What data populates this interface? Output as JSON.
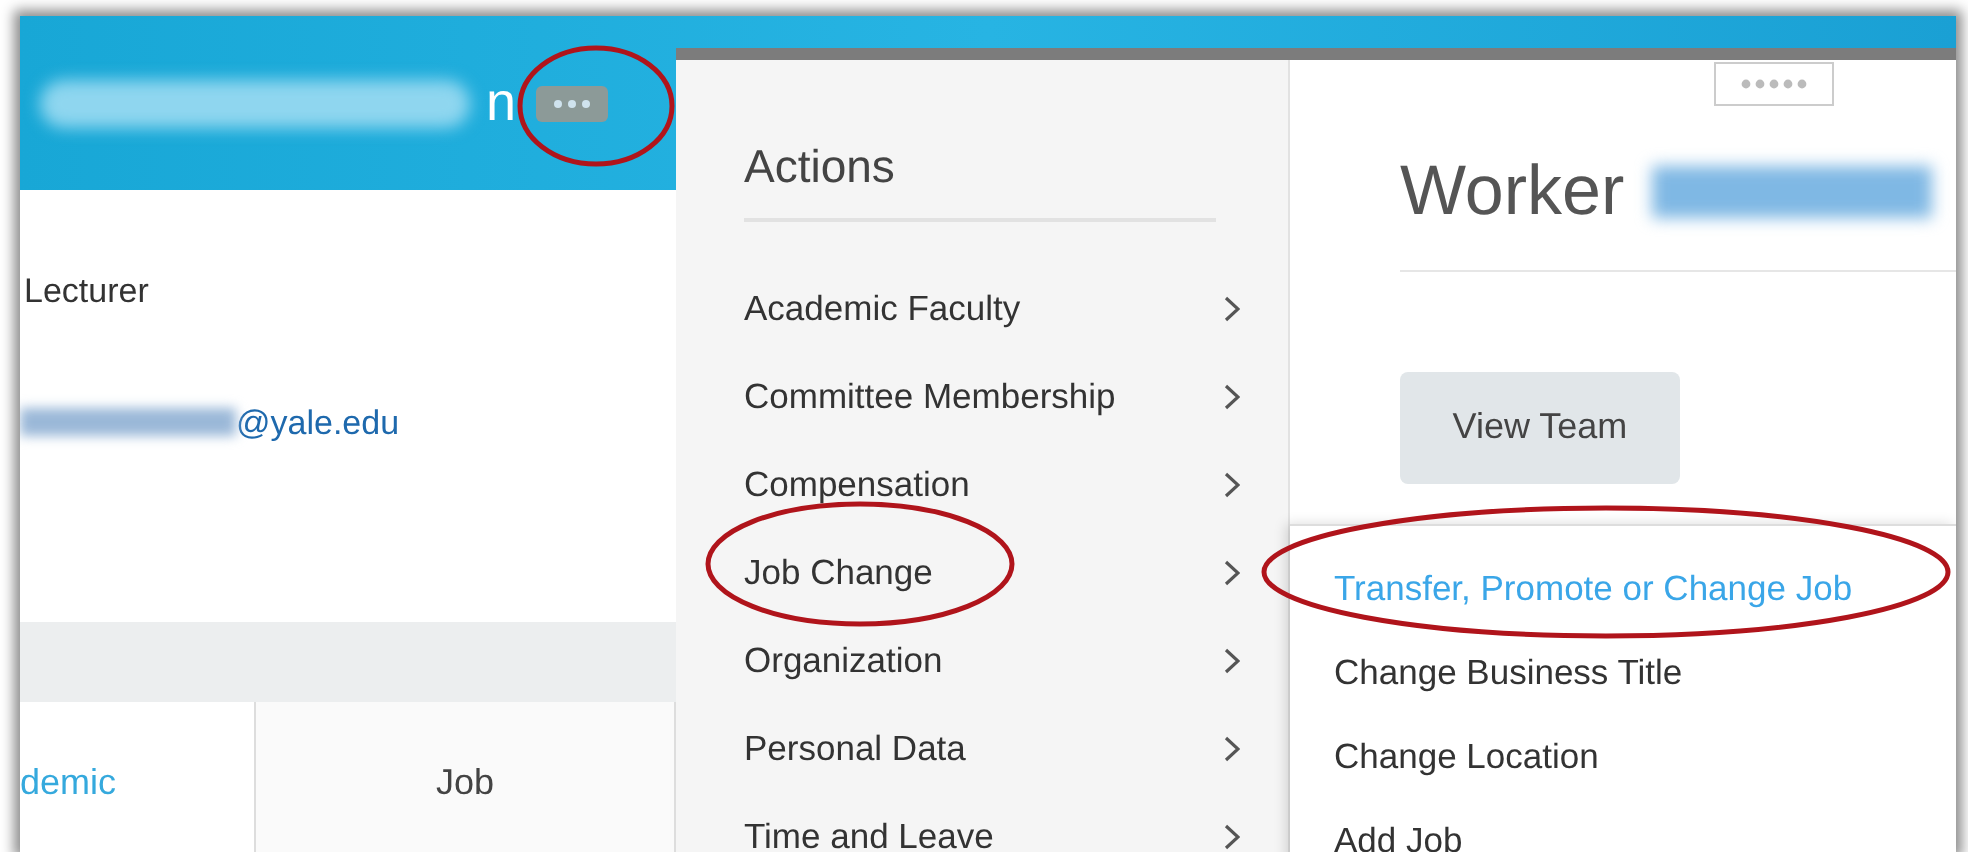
{
  "header": {
    "name": "n"
  },
  "profile": {
    "title": "Lecturer",
    "email": "@yale.edu"
  },
  "tabs": [
    {
      "label": "demic",
      "selected": true
    },
    {
      "label": "Job",
      "selected": false
    }
  ],
  "actions_menu": {
    "title": "Actions",
    "items": [
      {
        "label": "Academic Faculty"
      },
      {
        "label": "Committee Membership"
      },
      {
        "label": "Compensation"
      },
      {
        "label": "Job Change"
      },
      {
        "label": "Organization"
      },
      {
        "label": "Personal Data"
      },
      {
        "label": "Time and Leave"
      }
    ]
  },
  "worker_panel": {
    "title": "Worker",
    "button": "View Team"
  },
  "submenu": {
    "items": [
      {
        "label": "Transfer, Promote or Change Job",
        "selected": true
      },
      {
        "label": "Change Business Title",
        "selected": false
      },
      {
        "label": "Change Location",
        "selected": false
      },
      {
        "label": "Add Job",
        "selected": false
      }
    ]
  }
}
